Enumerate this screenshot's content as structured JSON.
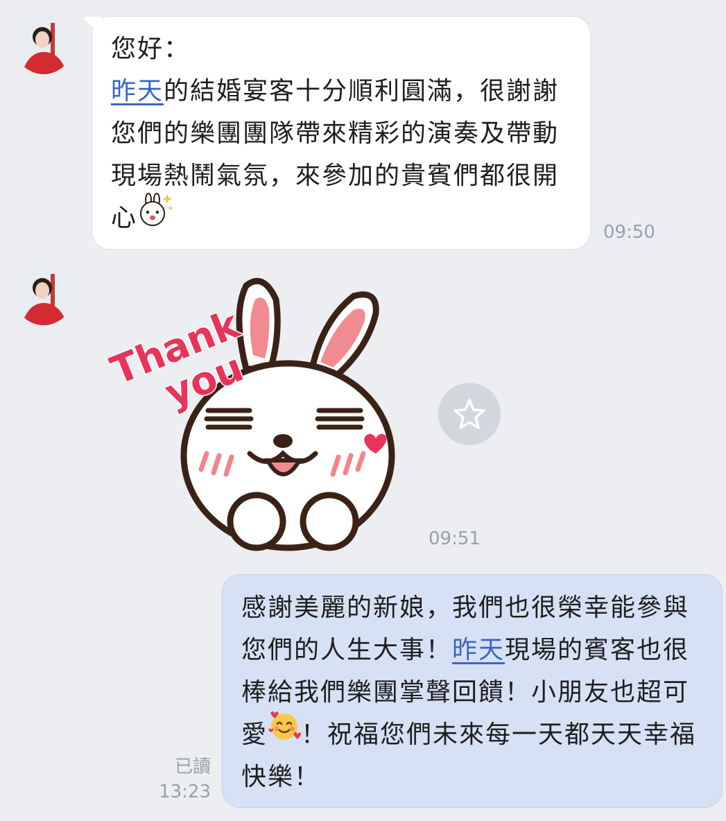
{
  "messages": [
    {
      "direction": "incoming",
      "type": "text",
      "greeting": "您好：",
      "link_text": "昨天",
      "body_after_link": "的結婚宴客十分順利圓滿，很謝謝您們的樂團團隊帶來精彩的演奏及帶動現場熱鬧氣氛，來參加的貴賓們都很開心",
      "trailing_emoji": "cony-sparkle-emoji",
      "time": "09:50"
    },
    {
      "direction": "incoming",
      "type": "sticker",
      "sticker": "thank-you-bunny-sticker",
      "sticker_text_line1": "Thank",
      "sticker_text_line2": "you",
      "time": "09:51"
    },
    {
      "direction": "outgoing",
      "type": "text",
      "part1": "感謝美麗的新娘，我們也很榮幸能參與您們的人生大事！",
      "link_text": "昨天",
      "part2": "現場的賓客也很棒給我們樂團掌聲回饋！小朋友也超可愛",
      "emoji": "smiling-face-with-hearts-emoji",
      "part3": "！祝福您們未來每一天都天天幸福快樂！",
      "read_label": "已讀",
      "time": "13:23"
    }
  ],
  "colors": {
    "background": "#eceef2",
    "incoming_bubble": "#ffffff",
    "outgoing_bubble": "#d7e1f6",
    "link": "#3a64c9",
    "timestamp": "#9aa0aa"
  }
}
